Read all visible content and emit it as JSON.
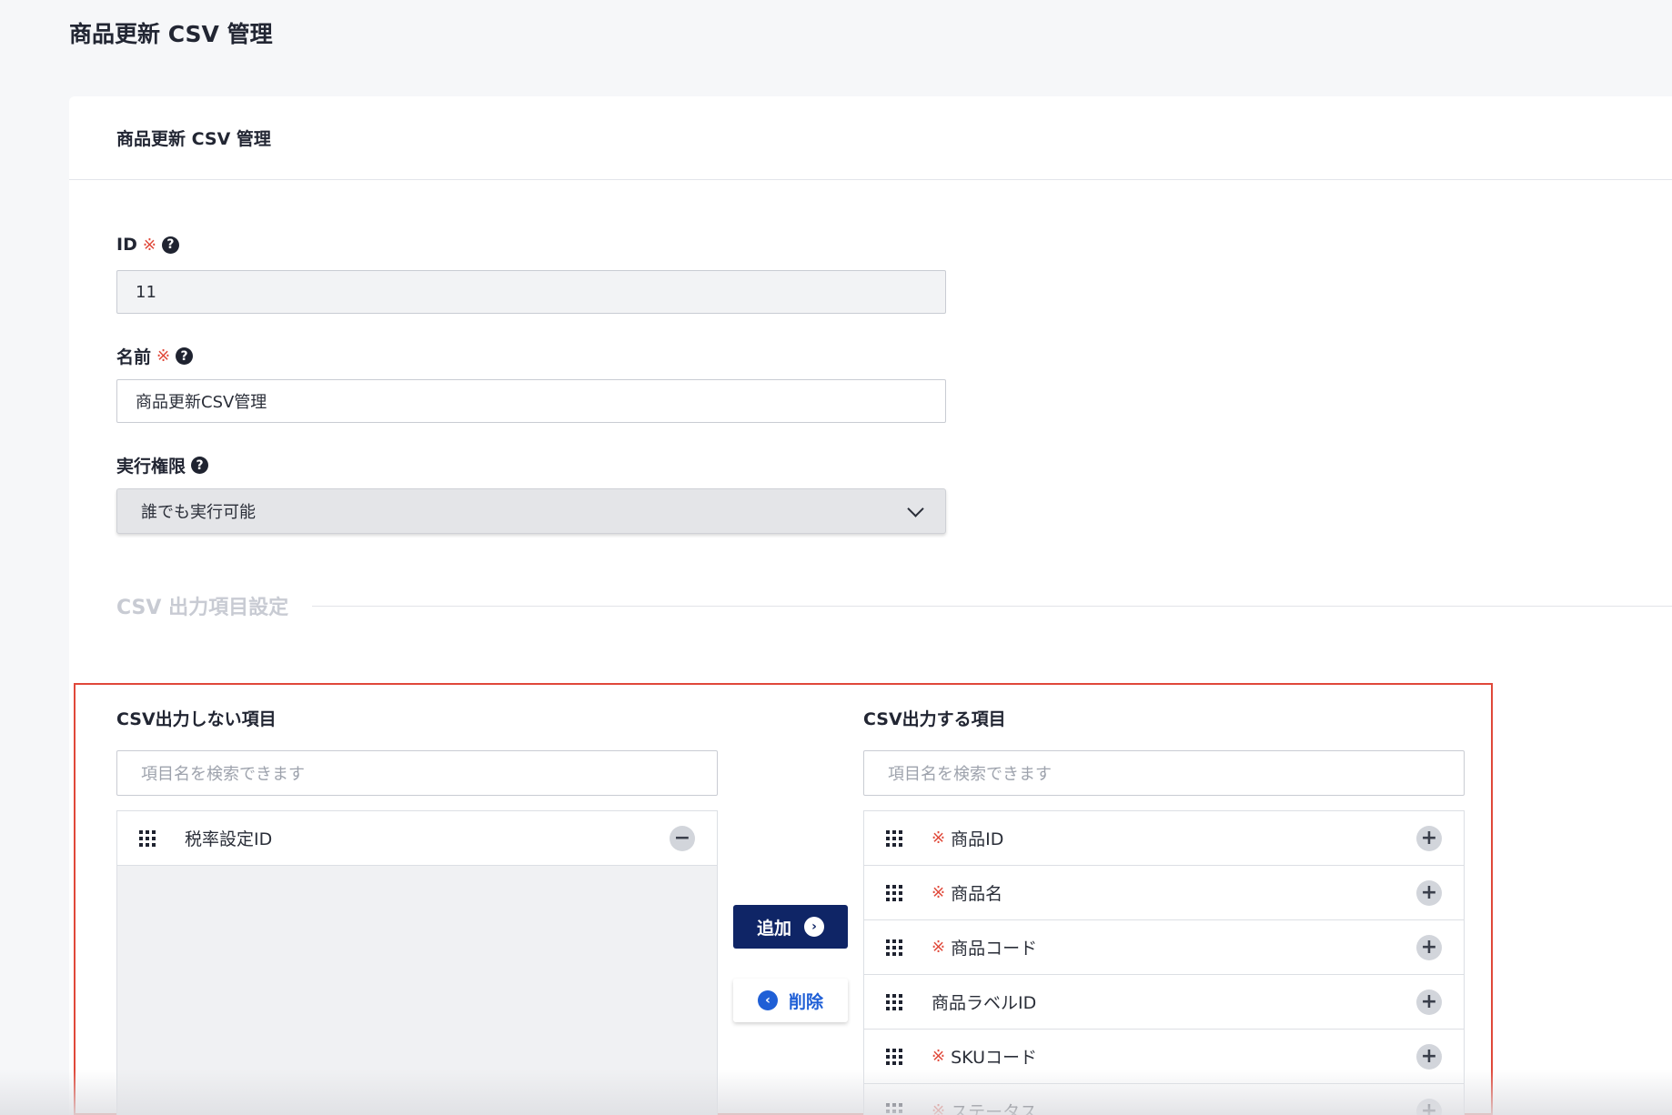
{
  "page": {
    "title": "商品更新 CSV 管理"
  },
  "card": {
    "title": "商品更新 CSV 管理"
  },
  "form": {
    "id": {
      "label": "ID",
      "required_mark": "※",
      "value": "11"
    },
    "name": {
      "label": "名前",
      "required_mark": "※",
      "value": "商品更新CSV管理"
    },
    "permission": {
      "label": "実行権限",
      "selected": "誰でも実行可能"
    }
  },
  "section": {
    "title": "CSV 出力項目設定"
  },
  "excluded": {
    "label": "CSV出力しない項目",
    "search_placeholder": "項目名を検索できます",
    "items": [
      {
        "label": "税率設定ID",
        "required": false
      }
    ]
  },
  "included": {
    "label": "CSV出力する項目",
    "search_placeholder": "項目名を検索できます",
    "items": [
      {
        "label": "商品ID",
        "required": true
      },
      {
        "label": "商品名",
        "required": true
      },
      {
        "label": "商品コード",
        "required": true
      },
      {
        "label": "商品ラベルID",
        "required": false
      },
      {
        "label": "SKUコード",
        "required": true
      },
      {
        "label": "ステータス",
        "required": true
      }
    ]
  },
  "buttons": {
    "add": "追加",
    "remove": "削除"
  },
  "icons": {
    "help": "question-circle-icon",
    "grip": "drag-grip-icon",
    "minus": "minus-circle-icon",
    "plus": "plus-circle-icon",
    "arrow_right": "chevron-right-circle-icon",
    "arrow_left": "chevron-left-circle-icon",
    "dropdown": "chevron-down-icon"
  },
  "colors": {
    "required": "#e04a3b",
    "primary_button": "#0f2566",
    "link_blue": "#1f5fd6",
    "highlight_border": "#e0483a"
  }
}
